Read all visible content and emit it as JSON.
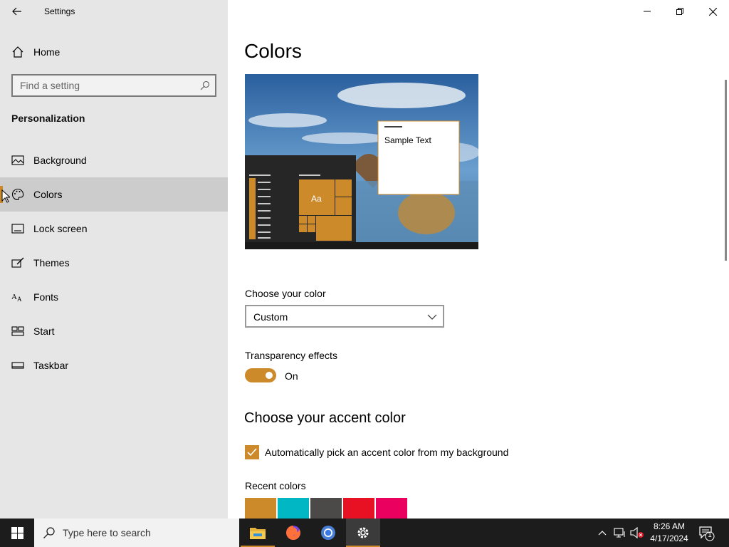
{
  "window": {
    "title": "Settings",
    "controls": [
      "minimize",
      "restore",
      "close"
    ]
  },
  "sidebar": {
    "home_label": "Home",
    "search_placeholder": "Find a setting",
    "section_title": "Personalization",
    "items": [
      {
        "label": "Background",
        "icon": "picture-icon"
      },
      {
        "label": "Colors",
        "icon": "palette-icon",
        "selected": true
      },
      {
        "label": "Lock screen",
        "icon": "lock-screen-icon"
      },
      {
        "label": "Themes",
        "icon": "brush-icon"
      },
      {
        "label": "Fonts",
        "icon": "font-icon"
      },
      {
        "label": "Start",
        "icon": "start-icon"
      },
      {
        "label": "Taskbar",
        "icon": "taskbar-icon"
      }
    ]
  },
  "main": {
    "title": "Colors",
    "preview": {
      "sample_text": "Sample Text",
      "tile_text": "Aa"
    },
    "choose_color": {
      "label": "Choose your color",
      "value": "Custom"
    },
    "transparency": {
      "label": "Transparency effects",
      "state": "On"
    },
    "accent": {
      "heading": "Choose your accent color",
      "auto_pick_label": "Automatically pick an accent color from my background",
      "auto_pick_checked": true,
      "recent_label": "Recent colors",
      "recent_colors": [
        "#cc8a2a",
        "#00b7c3",
        "#4c4a48",
        "#e81123",
        "#ea005e"
      ]
    }
  },
  "taskbar": {
    "search_placeholder": "Type here to search",
    "apps": [
      "file-explorer-icon",
      "firefox-icon",
      "chrome-icon",
      "settings-icon"
    ],
    "clock_time": "8:26 AM",
    "clock_date": "4/17/2024",
    "notification_count": "1"
  },
  "colors": {
    "accent": "#cc8a2a",
    "sidebar_bg": "#e6e6e6",
    "selected_bg": "#cccccc",
    "taskbar_bg": "#1c1c1c"
  }
}
